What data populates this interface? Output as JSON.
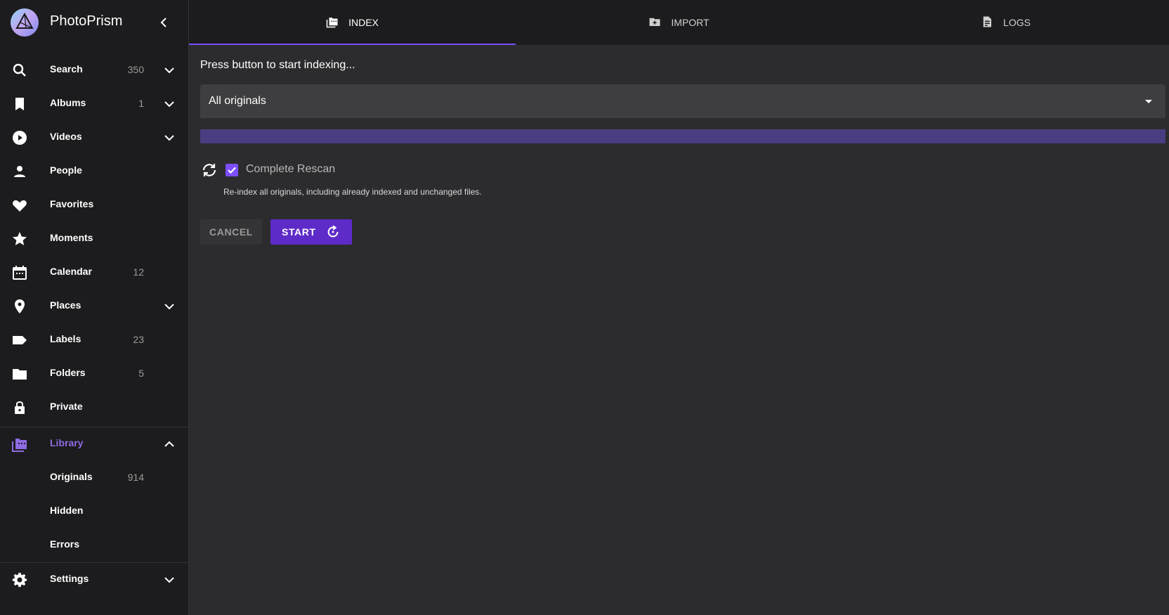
{
  "app": {
    "name": "PhotoPrism"
  },
  "sidebar": {
    "items": [
      {
        "label": "Search",
        "count": "350",
        "icon": "search-icon",
        "expand": true
      },
      {
        "label": "Albums",
        "count": "1",
        "icon": "bookmark-icon",
        "expand": true
      },
      {
        "label": "Videos",
        "count": "",
        "icon": "play-circle-icon",
        "expand": true
      },
      {
        "label": "People",
        "count": "",
        "icon": "person-icon",
        "expand": false
      },
      {
        "label": "Favorites",
        "count": "",
        "icon": "heart-icon",
        "expand": false
      },
      {
        "label": "Moments",
        "count": "",
        "icon": "star-icon",
        "expand": false
      },
      {
        "label": "Calendar",
        "count": "12",
        "icon": "calendar-icon",
        "expand": false
      },
      {
        "label": "Places",
        "count": "",
        "icon": "map-pin-icon",
        "expand": true
      },
      {
        "label": "Labels",
        "count": "23",
        "icon": "label-icon",
        "expand": false
      },
      {
        "label": "Folders",
        "count": "5",
        "icon": "folder-icon",
        "expand": false
      },
      {
        "label": "Private",
        "count": "",
        "icon": "lock-icon",
        "expand": false
      }
    ],
    "library": {
      "label": "Library",
      "icon": "library-icon"
    },
    "library_sub": [
      {
        "label": "Originals",
        "count": "914"
      },
      {
        "label": "Hidden",
        "count": ""
      },
      {
        "label": "Errors",
        "count": ""
      }
    ],
    "settings": {
      "label": "Settings",
      "icon": "gear-icon"
    }
  },
  "tabs": [
    {
      "label": "INDEX",
      "icon": "folder-library-icon",
      "active": true
    },
    {
      "label": "IMPORT",
      "icon": "folder-plus-icon",
      "active": false
    },
    {
      "label": "LOGS",
      "icon": "document-icon",
      "active": false
    }
  ],
  "index": {
    "heading": "Press button to start indexing...",
    "select_value": "All originals",
    "progress": 0,
    "checkbox_label": "Complete Rescan",
    "checkbox_checked": true,
    "hint": "Re-index all originals, including already indexed and unchanged files.",
    "cancel_label": "CANCEL",
    "start_label": "START"
  },
  "colors": {
    "accent": "#7c4dff",
    "start_button": "#5e2bc8",
    "sidebar_bg": "#1c1c1e",
    "content_bg": "#2c2c2e"
  }
}
